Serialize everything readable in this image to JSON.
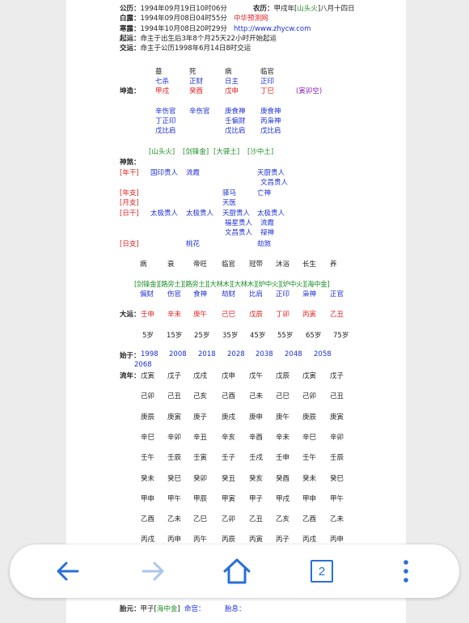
{
  "info": {
    "gongli": {
      "label": "公历：",
      "value": "1994年09月19日10时06分"
    },
    "nongli": {
      "label": "农历：",
      "pre": "甲戌年[",
      "nayin": "山头火",
      "post": "]八月十四日"
    },
    "bailu": {
      "label": "白露：",
      "value": "1994年09月08日04时55分"
    },
    "site_name": "中华预测网",
    "hanlu": {
      "label": "寒露：",
      "value": "1994年10月08日20时29分"
    },
    "site_url": "http://www.zhycw.com",
    "qiyun": {
      "label": "起运：",
      "value": "命主于出生后3年8个月25天22小时开始起运"
    },
    "jiaoyun": {
      "label": "交运：",
      "value": "命主于公历1998年6月14日8时交运"
    }
  },
  "pillars": {
    "gods": [
      "墓",
      "死",
      "病",
      "临官"
    ],
    "shishen": [
      "七杀",
      "正财",
      "日主",
      "正印"
    ],
    "label": "坤造：",
    "ganzhi": [
      "甲戌",
      "癸酉",
      "戊申",
      "丁巳"
    ],
    "kongwang": "(寅卯空)",
    "hidden": [
      [
        "辛伤官",
        "丁正印",
        "戊比肩"
      ],
      [
        "辛伤官"
      ],
      [
        "庚食神",
        "壬偏财",
        "戊比肩"
      ],
      [
        "庚食神",
        "丙枭神",
        "戊比肩"
      ]
    ],
    "nayin": [
      "[山头火]",
      "[剑锋金]",
      "[大驿土]",
      "[沙中土]"
    ]
  },
  "shensha": {
    "title": "神煞：",
    "rows": [
      {
        "label": "[年干]",
        "cols": [
          [
            "国印贵人"
          ],
          [
            "流霞"
          ],
          [],
          [
            "天厨贵人",
            "文昌贵人"
          ]
        ]
      },
      {
        "label": "[年支]",
        "cols": [
          [],
          [],
          [
            "驿马"
          ],
          [
            "亡神"
          ]
        ]
      },
      {
        "label": "[月支]",
        "cols": [
          [],
          [],
          [
            "天医"
          ],
          []
        ]
      },
      {
        "label": "[日干]",
        "cols": [
          [
            "太极贵人"
          ],
          [
            "太极贵人"
          ],
          [
            "天厨贵人",
            "福星贵人",
            "文昌贵人"
          ],
          [
            "太极贵人",
            "流霞",
            "禄神"
          ]
        ]
      },
      {
        "label": "[日支]",
        "cols": [
          [],
          [
            "桃花"
          ],
          [],
          [
            "劫煞"
          ]
        ]
      }
    ]
  },
  "changsheng": [
    "病",
    "衰",
    "帝旺",
    "临官",
    "冠带",
    "沐浴",
    "长生",
    "养"
  ],
  "dayun_nayin": [
    "[剑锋金]",
    "[路旁土]",
    "[路旁土]",
    "[大林木]",
    "[大林木]",
    "[炉中火]",
    "[炉中火]",
    "[海中金]"
  ],
  "dayun_shishen": [
    "偏财",
    "伤官",
    "食神",
    "劫财",
    "比肩",
    "正印",
    "枭神",
    "正官"
  ],
  "dayun": {
    "label": "大运：",
    "values": [
      "壬申",
      "辛未",
      "庚午",
      "己巳",
      "戊辰",
      "丁卯",
      "丙寅",
      "乙丑"
    ]
  },
  "ages": [
    "5岁",
    "15岁",
    "25岁",
    "35岁",
    "45岁",
    "55岁",
    "65岁",
    "75岁"
  ],
  "shiyu": {
    "label": "始于：",
    "years": [
      "1998",
      "2008",
      "2018",
      "2028",
      "2038",
      "2048",
      "2058"
    ],
    "last": "2068"
  },
  "liunian": {
    "label": "流年：",
    "rows": [
      [
        "戊寅",
        "戊子",
        "戊戌",
        "戊申",
        "戊午",
        "戊辰",
        "戊寅",
        "戊子"
      ],
      [
        "己卯",
        "己丑",
        "己亥",
        "己酉",
        "己未",
        "己巳",
        "己卯",
        "己丑"
      ],
      [
        "庚辰",
        "庚寅",
        "庚子",
        "庚戌",
        "庚申",
        "庚午",
        "庚辰",
        "庚寅"
      ],
      [
        "辛巳",
        "辛卯",
        "辛丑",
        "辛亥",
        "辛酉",
        "辛未",
        "辛巳",
        "辛卯"
      ],
      [
        "壬午",
        "壬辰",
        "壬寅",
        "壬子",
        "壬戌",
        "壬申",
        "壬午",
        "壬辰"
      ],
      [
        "癸未",
        "癸巳",
        "癸卯",
        "癸丑",
        "癸亥",
        "癸酉",
        "癸未",
        "癸巳"
      ],
      [
        "甲申",
        "甲午",
        "甲辰",
        "甲寅",
        "甲子",
        "甲戌",
        "甲申",
        "甲午"
      ],
      [
        "乙酉",
        "乙未",
        "乙巳",
        "乙卯",
        "乙丑",
        "乙亥",
        "乙酉",
        "乙未"
      ],
      [
        "丙戌",
        "丙申",
        "丙午",
        "丙辰",
        "丙寅",
        "丙子",
        "丙戌",
        "丙申"
      ]
    ]
  },
  "bottom_partial": {
    "label": "胎元：",
    "pre": "甲子[",
    "nayin": "海中金",
    "post": "]",
    "mid": "命宫：",
    "mid2": "胎息："
  },
  "nav": {
    "back": "back-arrow",
    "forward": "forward-arrow",
    "home": "home-icon",
    "tabs_count": "2",
    "menu": "more-vertical-icon"
  },
  "colors": {
    "blue": "#1c2fd6",
    "red": "#e0201e",
    "green": "#1e8f27",
    "purple": "#8a1ab8",
    "nav_icon": "#2a6fd8",
    "nav_disabled": "#a9c6ee"
  }
}
